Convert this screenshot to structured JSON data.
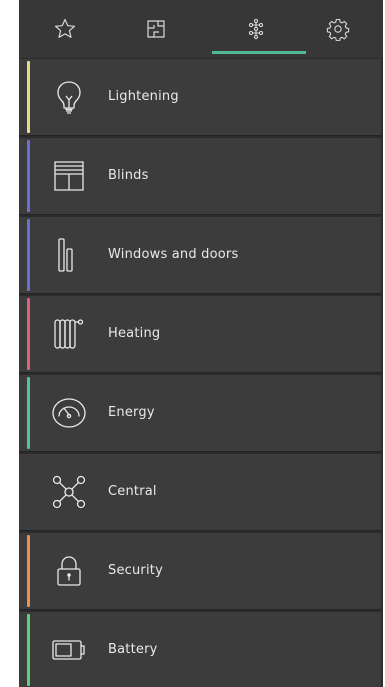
{
  "nav": {
    "tabs": [
      {
        "icon": "star-icon"
      },
      {
        "icon": "floorplan-icon"
      },
      {
        "icon": "categories-icon",
        "active": true
      },
      {
        "icon": "gear-icon"
      }
    ],
    "accent_color": "#53b89a"
  },
  "categories": [
    {
      "label": "Lightening",
      "icon": "lightbulb-icon",
      "color": "#e7dc80"
    },
    {
      "label": "Blinds",
      "icon": "blinds-icon",
      "color": "#6a72d1"
    },
    {
      "label": "Windows and doors",
      "icon": "window-door-icon",
      "color": "#6a72d1"
    },
    {
      "label": "Heating",
      "icon": "radiator-icon",
      "color": "#e0607d"
    },
    {
      "label": "Energy",
      "icon": "gauge-icon",
      "color": "#55c392"
    },
    {
      "label": "Central",
      "icon": "network-hub-icon",
      "color": ""
    },
    {
      "label": "Security",
      "icon": "lock-icon",
      "color": "#e9914f"
    },
    {
      "label": "Battery",
      "icon": "battery-icon",
      "color": "#5fcf7a"
    }
  ]
}
